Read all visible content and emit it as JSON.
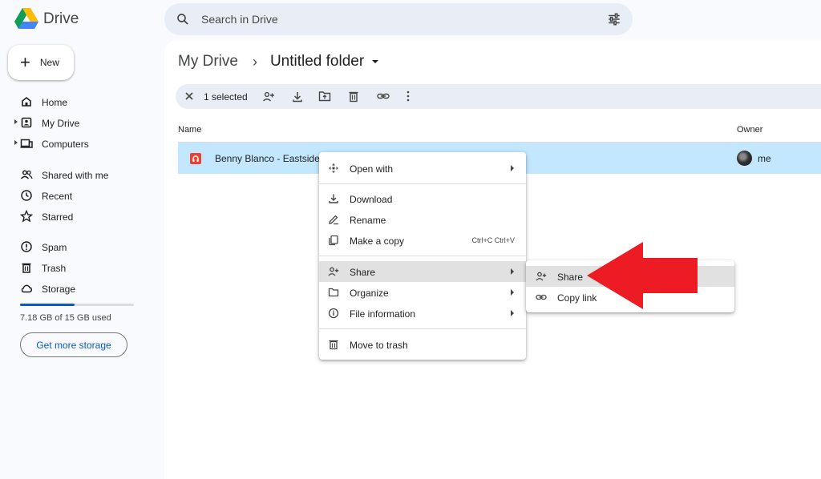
{
  "app": {
    "name": "Drive"
  },
  "search": {
    "placeholder": "Search in Drive"
  },
  "new_button": {
    "label": "New"
  },
  "sidebar": {
    "items": [
      {
        "label": "Home",
        "icon": "home-icon"
      },
      {
        "label": "My Drive",
        "icon": "my-drive-icon"
      },
      {
        "label": "Computers",
        "icon": "computers-icon"
      },
      {
        "label": "Shared with me",
        "icon": "shared-icon"
      },
      {
        "label": "Recent",
        "icon": "clock-icon"
      },
      {
        "label": "Starred",
        "icon": "star-icon"
      },
      {
        "label": "Spam",
        "icon": "spam-icon"
      },
      {
        "label": "Trash",
        "icon": "trash-icon"
      },
      {
        "label": "Storage",
        "icon": "cloud-icon"
      }
    ],
    "storage": {
      "used_text": "7.18 GB of 15 GB used",
      "fraction": 0.48,
      "button": "Get more storage"
    }
  },
  "breadcrumb": {
    "root": "My Drive",
    "current": "Untitled folder"
  },
  "selection_bar": {
    "text": "1 selected"
  },
  "table": {
    "headers": {
      "name": "Name",
      "owner": "Owner"
    },
    "rows": [
      {
        "name": "Benny Blanco - Eastside",
        "owner": "me"
      }
    ]
  },
  "context_menu": {
    "items": [
      {
        "label": "Open with",
        "icon": "move-icon",
        "submenu": true
      },
      {
        "label": "Download",
        "icon": "download-icon"
      },
      {
        "label": "Rename",
        "icon": "pencil-icon"
      },
      {
        "label": "Make a copy",
        "icon": "copy-icon",
        "shortcut": "Ctrl+C Ctrl+V"
      },
      {
        "label": "Share",
        "icon": "person-add-icon",
        "submenu": true
      },
      {
        "label": "Organize",
        "icon": "folder-icon",
        "submenu": true
      },
      {
        "label": "File information",
        "icon": "info-icon",
        "submenu": true
      },
      {
        "label": "Move to trash",
        "icon": "trash-icon"
      }
    ]
  },
  "share_submenu": {
    "items": [
      {
        "label": "Share",
        "icon": "person-add-icon"
      },
      {
        "label": "Copy link",
        "icon": "link-icon"
      }
    ]
  },
  "colors": {
    "accent": "#0b57d0",
    "selected_row": "#c2e7ff",
    "arrow": "#ed1c24"
  }
}
